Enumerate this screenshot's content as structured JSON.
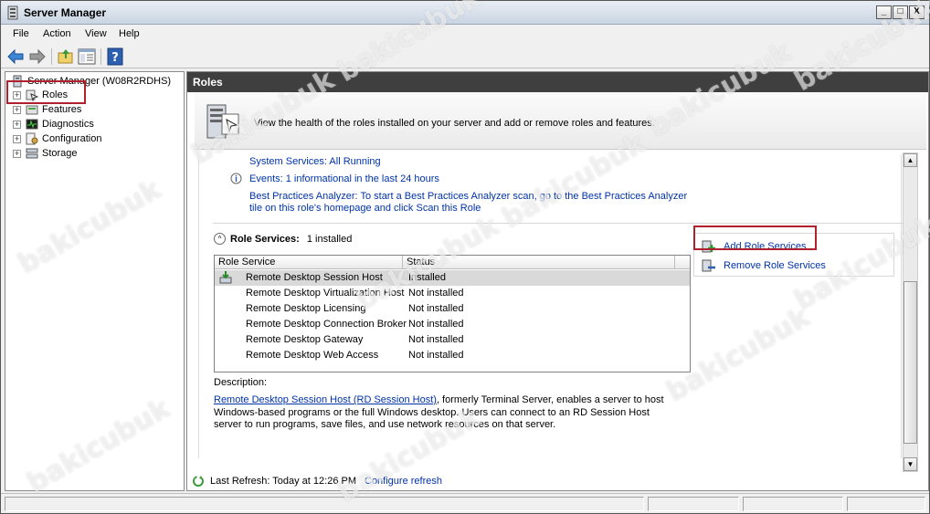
{
  "window": {
    "title": "Server Manager",
    "controls": [
      "_",
      "□",
      "X"
    ]
  },
  "menu": {
    "items": [
      "File",
      "Action",
      "View",
      "Help"
    ]
  },
  "toolbar": {
    "icons": [
      "back-icon",
      "forward-icon",
      "up-icon",
      "show-hide-tree-icon",
      "help-icon"
    ]
  },
  "tree": {
    "root": "Server Manager (W08R2RDHS)",
    "items": [
      {
        "label": "Roles",
        "icon": "roles-icon"
      },
      {
        "label": "Features",
        "icon": "features-icon"
      },
      {
        "label": "Diagnostics",
        "icon": "diagnostics-icon"
      },
      {
        "label": "Configuration",
        "icon": "configuration-icon"
      },
      {
        "label": "Storage",
        "icon": "storage-icon"
      }
    ]
  },
  "pane": {
    "header": "Roles",
    "banner_text": "View the health of the roles installed on your server and add or remove roles and features."
  },
  "summary": {
    "system_services": "System Services: All Running",
    "events": "Events: 1 informational in the last 24 hours",
    "bpa_line1": "Best Practices Analyzer: To start a Best Practices Analyzer scan, go to the Best Practices Analyzer",
    "bpa_line2": "tile on this role's homepage and click Scan this Role"
  },
  "role_services": {
    "title": "Role Services:",
    "count": "1 installed",
    "columns": [
      "Role Service",
      "Status"
    ],
    "rows": [
      {
        "name": "Remote Desktop Session Host",
        "status": "Installed"
      },
      {
        "name": "Remote Desktop Virtualization Host",
        "status": "Not installed"
      },
      {
        "name": "Remote Desktop Licensing",
        "status": "Not installed"
      },
      {
        "name": "Remote Desktop Connection Broker",
        "status": "Not installed"
      },
      {
        "name": "Remote Desktop Gateway",
        "status": "Not installed"
      },
      {
        "name": "Remote Desktop Web Access",
        "status": "Not installed"
      }
    ],
    "actions": {
      "add": "Add Role Services",
      "remove": "Remove Role Services"
    }
  },
  "description": {
    "label": "Description:",
    "link": "Remote Desktop Session Host (RD Session Host)",
    "text_line1": ", formerly Terminal Server, enables a server to host",
    "text_line2": "Windows-based programs or the full Windows desktop. Users can connect to an RD Session Host",
    "text_line3": "server to run programs, save files, and use network resources on that server."
  },
  "footer": {
    "last_refresh": "Last Refresh: Today at 12:26 PM",
    "configure": "Configure refresh"
  },
  "watermark": "bakicubuk",
  "colors": {
    "highlight": "#b1212d",
    "link": "#0033aa",
    "header": "#3f3f3f"
  }
}
